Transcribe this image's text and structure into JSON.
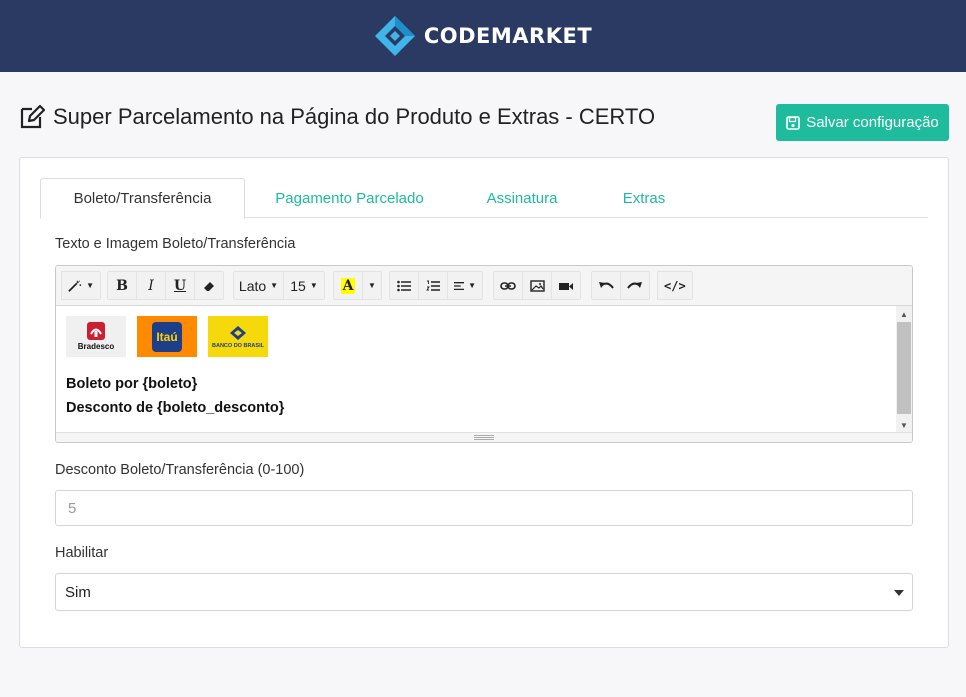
{
  "brand": {
    "name": "CODEMARKET",
    "colors": {
      "header_bg": "#2a3a63",
      "logo_light": "#3fb5e8",
      "logo_dark": "#1f8fc9",
      "accent": "#1ebc9c"
    }
  },
  "page": {
    "title": "Super Parcelamento na Página do Produto e Extras - CERTO",
    "title_icon": "edit-icon"
  },
  "toolbar": {
    "save_label": "Salvar configuração",
    "save_icon": "save-icon"
  },
  "tabs": [
    {
      "label": "Boleto/Transferência",
      "active": true
    },
    {
      "label": "Pagamento Parcelado",
      "active": false
    },
    {
      "label": "Assinatura",
      "active": false
    },
    {
      "label": "Extras",
      "active": false
    }
  ],
  "editor_section": {
    "label": "Texto e Imagem Boleto/Transferência",
    "font_name": "Lato",
    "font_size": "15",
    "toolbar_icons": [
      "magic-icon",
      "bold-icon",
      "italic-icon",
      "underline-icon",
      "eraser-icon",
      "font-name-dropdown",
      "font-size-dropdown",
      "font-color-icon",
      "unordered-list-icon",
      "ordered-list-icon",
      "paragraph-align-icon",
      "link-icon",
      "picture-icon",
      "video-icon",
      "undo-icon",
      "redo-icon",
      "code-view-icon"
    ],
    "banks": [
      {
        "name": "Bradesco",
        "bg": "#f0f0f0",
        "text_color": "#111"
      },
      {
        "name": "Itaú",
        "bg": "#ff8a00",
        "text_color": "#ffffff"
      },
      {
        "name": "BANCO DO BRASIL",
        "bg": "#f5d90a",
        "text_color": "#1d3f8a"
      }
    ],
    "lines": [
      "Boleto por {boleto}",
      "Desconto de {boleto_desconto}"
    ]
  },
  "discount": {
    "label": "Desconto Boleto/Transferência (0-100)",
    "placeholder": "5",
    "value": ""
  },
  "enable": {
    "label": "Habilitar",
    "selected": "Sim"
  }
}
